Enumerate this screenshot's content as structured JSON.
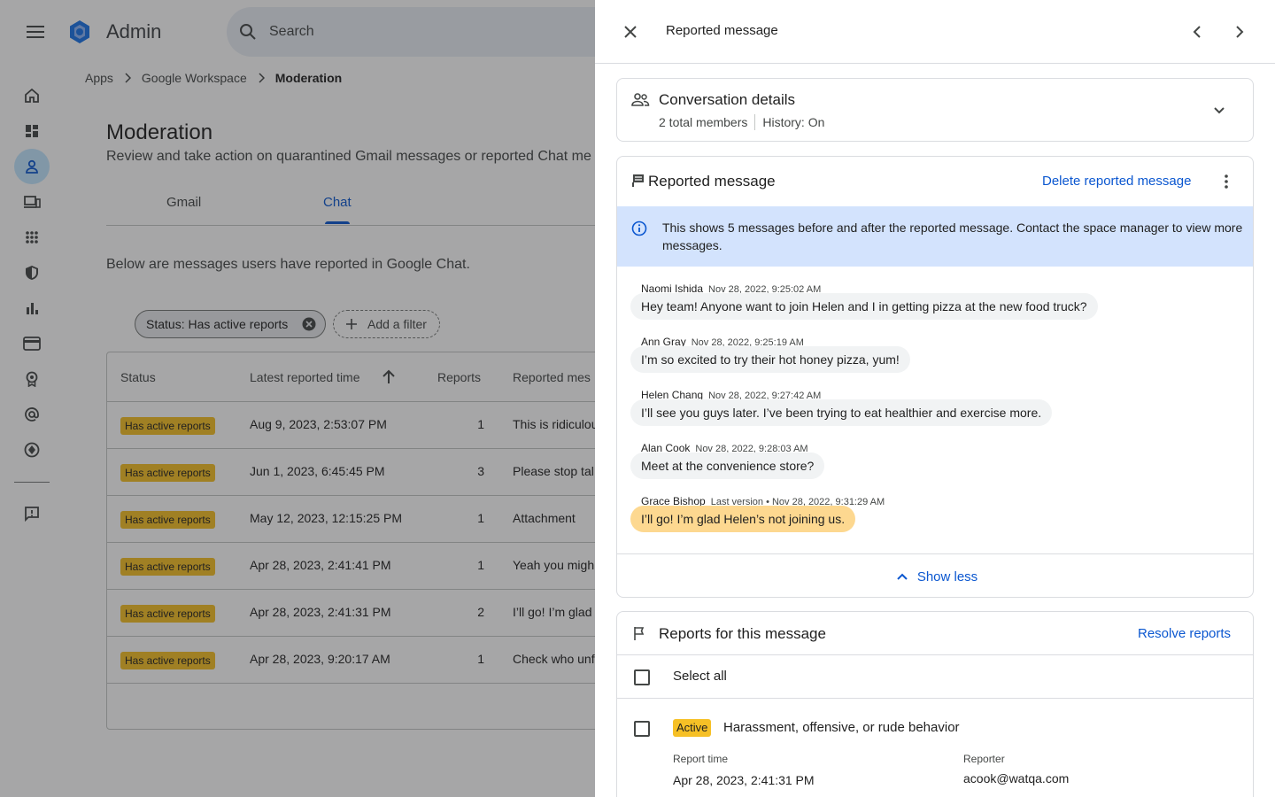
{
  "app": {
    "brand": "Admin",
    "search_placeholder": "Search",
    "breadcrumb": [
      "Apps",
      "Google Workspace",
      "Moderation"
    ]
  },
  "moderation": {
    "title": "Moderation",
    "description": "Review and take action on quarantined Gmail messages or reported Chat me",
    "tabs": [
      "Gmail",
      "Chat"
    ],
    "active_tab": "Chat",
    "lead": "Below are messages users have reported in Google Chat.",
    "filter_chip": "Status: Has active reports",
    "add_filter": "Add a filter",
    "columns": [
      "Status",
      "Latest reported time",
      "Reports",
      "Reported mes"
    ],
    "rows": [
      {
        "status": "Has active reports",
        "time": "Aug 9, 2023, 2:53:07 PM",
        "reports": "1",
        "message": "This is ridiculou"
      },
      {
        "status": "Has active reports",
        "time": "Jun 1, 2023, 6:45:45 PM",
        "reports": "3",
        "message": "Please stop tal"
      },
      {
        "status": "Has active reports",
        "time": "May 12, 2023, 12:15:25 PM",
        "reports": "1",
        "message": "Attachment"
      },
      {
        "status": "Has active reports",
        "time": "Apr 28, 2023, 2:41:41 PM",
        "reports": "1",
        "message": "Yeah you migh"
      },
      {
        "status": "Has active reports",
        "time": "Apr 28, 2023, 2:41:31 PM",
        "reports": "2",
        "message": "I’ll go! I’m glad"
      },
      {
        "status": "Has active reports",
        "time": "Apr 28, 2023, 9:20:17 AM",
        "reports": "1",
        "message": "Check who unf"
      }
    ]
  },
  "panel": {
    "title": "Reported message",
    "conversation": {
      "title": "Conversation details",
      "members": "2 total members",
      "history": "History: On"
    },
    "reported": {
      "title": "Reported message",
      "delete_label": "Delete reported message",
      "info": "This shows 5 messages before and after the reported message. Contact the space manager to view more messages.",
      "messages": [
        {
          "author": "Naomi Ishida",
          "time": "Nov 28, 2022, 9:25:02 AM",
          "text": "Hey team! Anyone want to join Helen and I in getting pizza at the new food truck?"
        },
        {
          "author": "Ann Gray",
          "time": "Nov 28, 2022, 9:25:19 AM",
          "text": "I’m so excited to try their hot honey pizza, yum!"
        },
        {
          "author": "Helen Chang",
          "time": "Nov 28, 2022, 9:27:42 AM",
          "text": "I’ll see you guys later. I’ve been trying to eat healthier and exercise more."
        },
        {
          "author": "Alan Cook",
          "time": "Nov 28, 2022, 9:28:03 AM",
          "text": "Meet at the convenience store?"
        },
        {
          "author": "Grace Bishop",
          "time": "Last version • Nov 28, 2022, 9:31:29 AM",
          "text": "I’ll go! I’m glad Helen’s not joining us."
        }
      ],
      "show_less": "Show less"
    },
    "reports": {
      "title": "Reports for this message",
      "resolve_label": "Resolve reports",
      "select_all": "Select all",
      "items": [
        {
          "status": "Active",
          "reason": "Harassment, offensive, or rude behavior",
          "time_label": "Report time",
          "time": "Apr 28, 2023, 2:41:31 PM",
          "reporter_label": "Reporter",
          "reporter": "acook@watqa.com"
        }
      ]
    }
  },
  "colors": {
    "accent": "#0b57d0",
    "badge": "#f6c026",
    "info_bg": "#d3e3fd",
    "highlight_bubble": "#fdd890"
  }
}
